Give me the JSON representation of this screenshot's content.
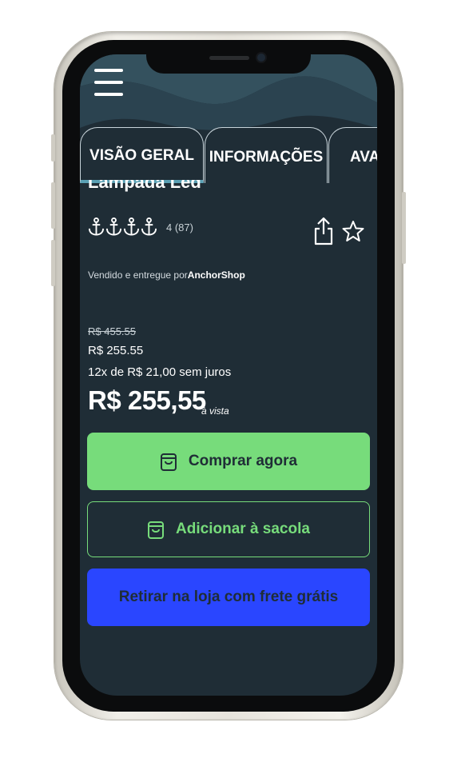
{
  "app": {
    "menu_icon": "hamburger-menu-icon",
    "colors": {
      "background": "#1f2d36",
      "accent_green": "#77dc7b",
      "accent_blue": "#2a46ff",
      "tab_indicator": "#5aa0b4"
    }
  },
  "tabs": [
    {
      "label": "VISÃO GERAL",
      "active": true
    },
    {
      "label": "INFORMAÇÕES",
      "active": false
    },
    {
      "label": "AVA",
      "active": false
    }
  ],
  "product": {
    "title": "Lampada Led",
    "rating": {
      "icon": "anchor-icon",
      "value": 4,
      "text": "4 (87)"
    },
    "share_icon": "share-icon",
    "favorite_icon": "star-icon",
    "seller_prefix": "Vendido e entregue por",
    "seller_name": "AnchorShop"
  },
  "pricing": {
    "old_price": "R$ 455.55",
    "price": "R$ 255.55",
    "installments": "12x de R$ 21,00 sem juros",
    "cash_price": "R$ 255,55",
    "cash_label": "à vista"
  },
  "actions": {
    "buy_now": "Comprar agora",
    "add_to_bag": "Adicionar à sacola",
    "pickup": "Retirar na loja com frete grátis"
  }
}
